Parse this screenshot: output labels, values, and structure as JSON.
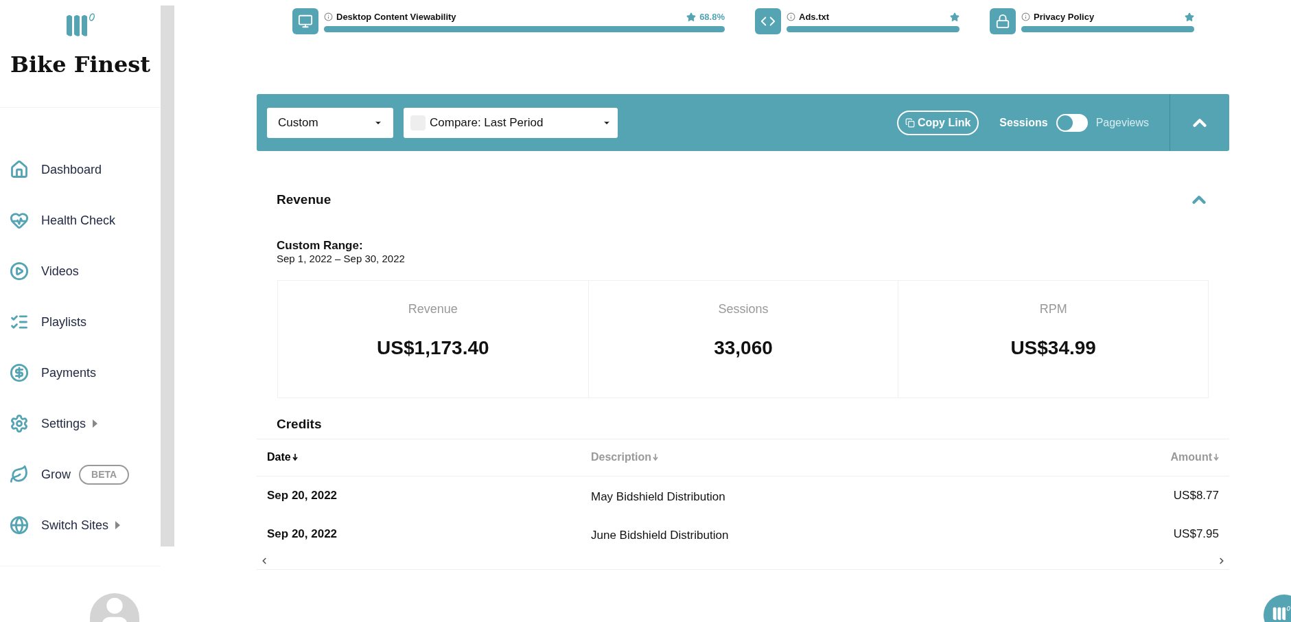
{
  "sidebar": {
    "site_name": "Bike Finest",
    "items": [
      {
        "kind": "home",
        "label": "Dashboard",
        "has_submenu": false
      },
      {
        "kind": "health",
        "label": "Health Check",
        "has_submenu": false
      },
      {
        "kind": "video",
        "label": "Videos",
        "has_submenu": false
      },
      {
        "kind": "list",
        "label": "Playlists",
        "has_submenu": false
      },
      {
        "kind": "money",
        "label": "Payments",
        "has_submenu": false
      },
      {
        "kind": "gear",
        "label": "Settings",
        "has_submenu": true
      },
      {
        "kind": "leaf",
        "label": "Grow",
        "has_submenu": false,
        "badge": "BETA"
      },
      {
        "kind": "globe",
        "label": "Switch Sites",
        "has_submenu": true
      }
    ]
  },
  "health_checks": [
    {
      "kind": "monitor",
      "label": "Desktop Content Viewability",
      "reading": "68.8%",
      "level": 1
    },
    {
      "kind": "code",
      "label": "Ads.txt",
      "level": 1
    },
    {
      "kind": "lock",
      "label": "Privacy Policy",
      "level": 1
    }
  ],
  "toolbar": {
    "range": "Custom",
    "compare": {
      "label": "Compare: Last Period",
      "checked": false
    },
    "copy_link": "Copy Link",
    "toggle": {
      "left": "Sessions",
      "right": "Pageviews",
      "on": false
    }
  },
  "revenue": {
    "title": "Revenue",
    "range_label": "Custom Range:",
    "range": "Sep 1, 2022 – Sep 30, 2022",
    "stats": [
      {
        "label": "Revenue",
        "value": "US$1,173.40"
      },
      {
        "label": "Sessions",
        "value": "33,060"
      },
      {
        "label": "RPM",
        "value": "US$34.99"
      }
    ]
  },
  "credits": {
    "title": "Credits",
    "columns": [
      {
        "label": "Date",
        "sorted": true
      },
      {
        "label": "Description",
        "sorted": false
      },
      {
        "label": "Amount",
        "sorted": false
      }
    ],
    "rows": [
      [
        "Sep 20, 2022",
        "May Bidshield Distribution",
        "US$8.77"
      ],
      [
        "Sep 20, 2022",
        "June Bidshield Distribution",
        "US$7.95"
      ]
    ]
  }
}
